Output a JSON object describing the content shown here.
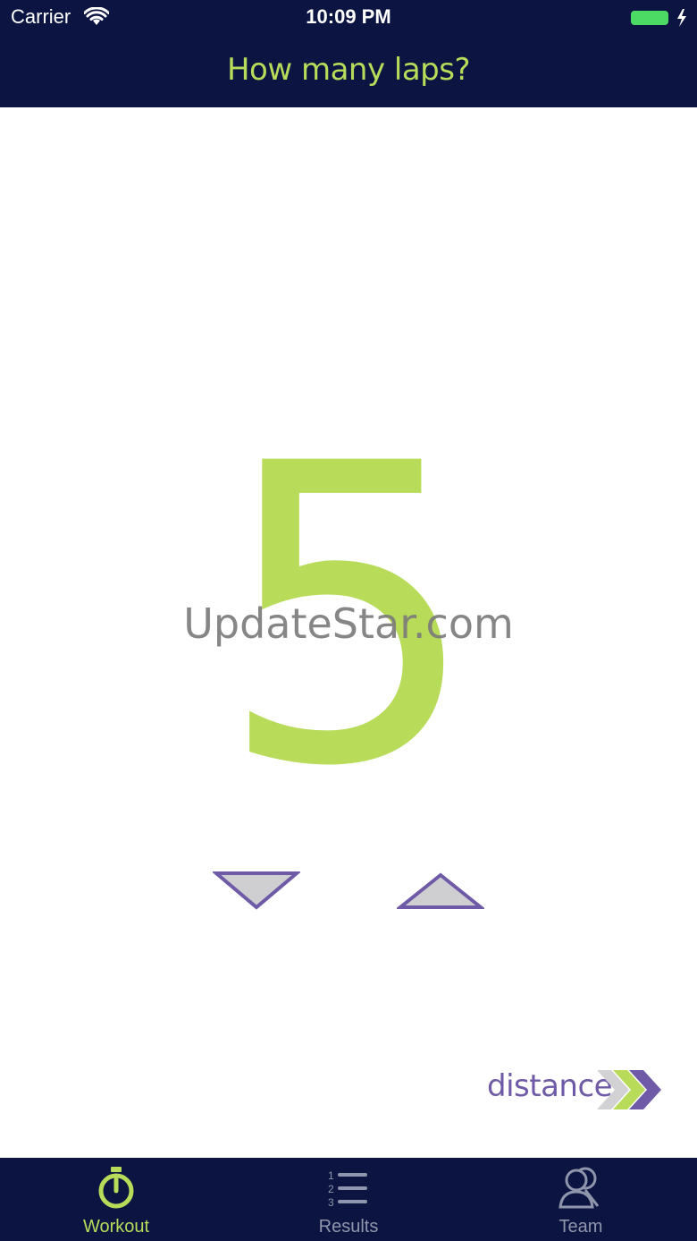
{
  "status_bar": {
    "carrier": "Carrier",
    "time": "10:09 PM",
    "battery_color": "#4cd964"
  },
  "nav": {
    "title": "How many laps?"
  },
  "main": {
    "lap_count": "5",
    "watermark": "UpdateStar.com",
    "decrement_icon": "triangle-down-icon",
    "increment_icon": "triangle-up-icon",
    "distance_label": "distance",
    "distance_icon": "chevrons-right-icon"
  },
  "tabs": [
    {
      "label": "Workout",
      "icon": "stopwatch-icon",
      "active": true
    },
    {
      "label": "Results",
      "icon": "numbered-list-icon",
      "active": false
    },
    {
      "label": "Team",
      "icon": "team-icon",
      "active": false
    }
  ],
  "colors": {
    "nav_background": "#0c1541",
    "accent_green": "#b8dc5a",
    "accent_purple": "#6e5aa6",
    "inactive_gray": "#8f95ab"
  }
}
